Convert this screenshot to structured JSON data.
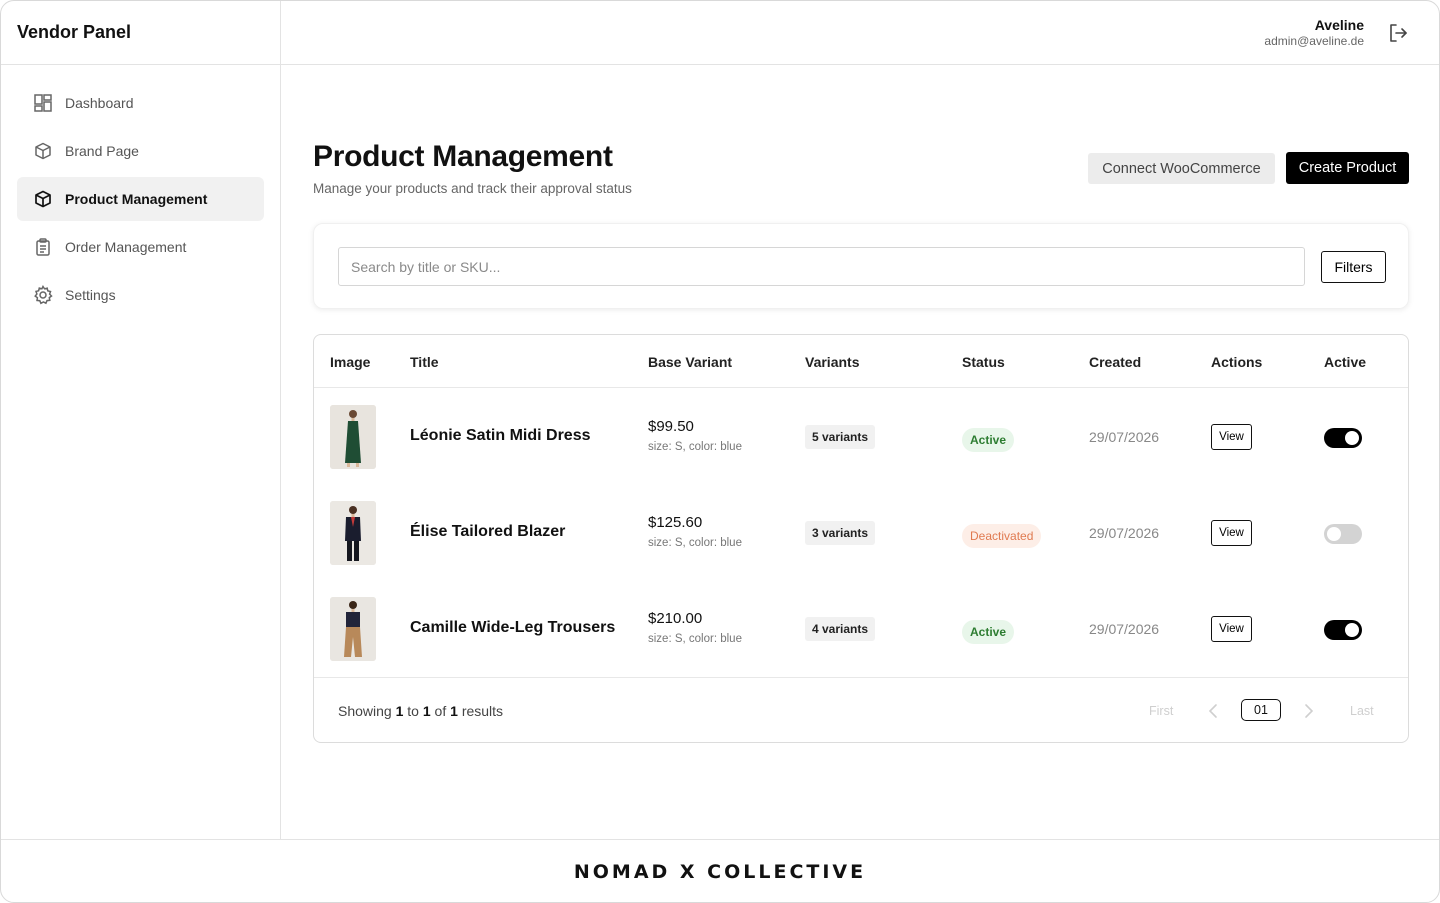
{
  "sidebar": {
    "brand": "Vendor Panel",
    "items": [
      {
        "label": "Dashboard",
        "icon": "dashboard-icon"
      },
      {
        "label": "Brand Page",
        "icon": "cube-icon"
      },
      {
        "label": "Product Management",
        "icon": "cube-icon",
        "active": true
      },
      {
        "label": "Order Management",
        "icon": "clipboard-icon"
      },
      {
        "label": "Settings",
        "icon": "gear-icon"
      }
    ]
  },
  "header": {
    "user_name": "Aveline",
    "user_email": "admin@aveline.de",
    "logout_icon": "logout-icon"
  },
  "main": {
    "title": "Product Management",
    "subtitle": "Manage your products and track their approval status",
    "connect_label": "Connect WooCommerce",
    "create_label": "Create Product"
  },
  "search": {
    "placeholder": "Search by title or SKU...",
    "value": "",
    "filters_label": "Filters"
  },
  "table": {
    "columns": [
      "Image",
      "Title",
      "Base Variant",
      "Variants",
      "Status",
      "Created",
      "Actions",
      "Active"
    ],
    "rows": [
      {
        "title": "Léonie Satin Midi Dress",
        "price": "$99.50",
        "variant": "size: S, color: blue",
        "variants": "5 variants",
        "status": "Active",
        "created": "29/07/2026",
        "action": "View",
        "active": true
      },
      {
        "title": "Élise Tailored Blazer",
        "price": "$125.60",
        "variant": "size: S, color: blue",
        "variants": "3 variants",
        "status": "Deactivated",
        "created": "29/07/2026",
        "action": "View",
        "active": false
      },
      {
        "title": "Camille Wide-Leg Trousers",
        "price": "$210.00",
        "variant": "size: S, color: blue",
        "variants": "4 variants",
        "status": "Active",
        "created": "29/07/2026",
        "action": "View",
        "active": true
      }
    ]
  },
  "pagination": {
    "showing_prefix": "Showing",
    "from": "1",
    "to_word": "to",
    "to": "1",
    "of_word": "of",
    "total": "1",
    "results_word": "results",
    "first": "First",
    "last": "Last",
    "current": "01"
  },
  "footer": {
    "logo": "NOMAD X COLLECTIVE"
  },
  "colors": {
    "accent": "#000000",
    "status_active_bg": "#e8f6ea",
    "status_active_text": "#2e7d32",
    "status_deactivated_bg": "#fdeee7",
    "status_deactivated_text": "#e07a50"
  }
}
